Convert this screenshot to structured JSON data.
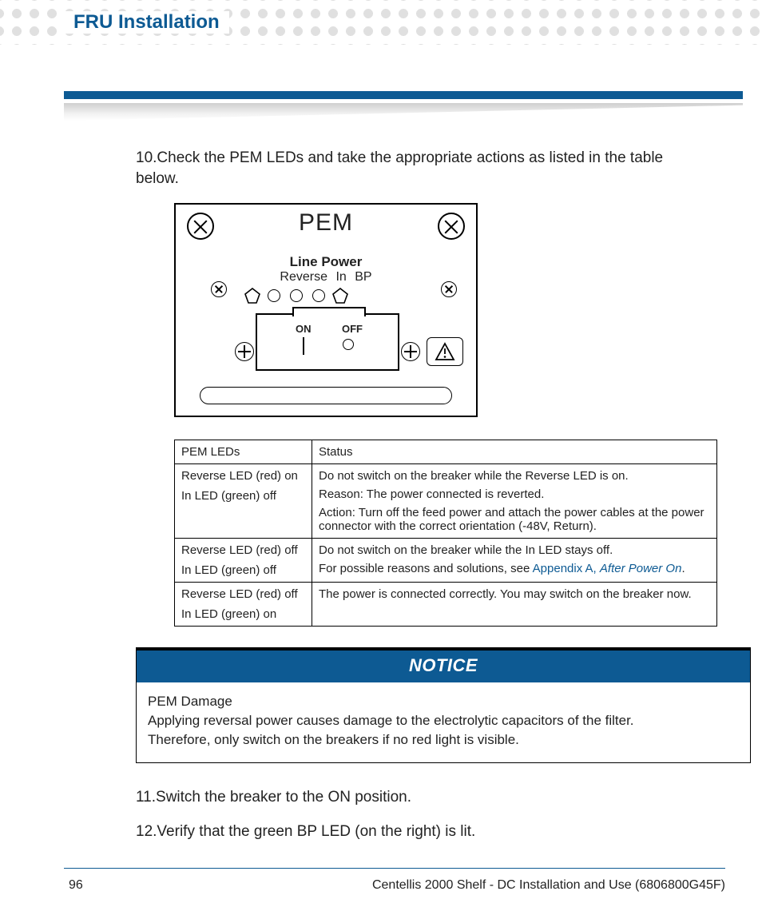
{
  "header": {
    "section_title": "FRU Installation"
  },
  "steps": {
    "s10": {
      "num": "10.",
      "text": "Check the PEM LEDs and take the appropriate actions as listed in the table below."
    },
    "s11": {
      "num": "11.",
      "text": "Switch the breaker to the ON position."
    },
    "s12": {
      "num": "12.",
      "text": "Verify that the green BP LED (on the right) is lit."
    }
  },
  "pem_diagram": {
    "title": "PEM",
    "line_power": "Line Power",
    "led_labels": "Reverse  In   BP",
    "on": "ON",
    "off": "OFF"
  },
  "led_table": {
    "headers": {
      "c1": "PEM LEDs",
      "c2": "Status"
    },
    "rows": [
      {
        "leds": [
          "Reverse LED (red) on",
          "In LED (green) off"
        ],
        "status": [
          "Do not switch on the breaker while the Reverse LED is on.",
          "Reason: The power connected is reverted.",
          "Action: Turn off the feed power and attach the power cables at the power connector with the correct orientation (-48V, Return)."
        ]
      },
      {
        "leds": [
          "Reverse LED (red) off",
          "In LED (green) off"
        ],
        "status": [
          "Do not switch on the breaker while the In LED stays off."
        ],
        "ref_prefix": "For possible reasons and solutions, see ",
        "ref_a": "Appendix A, ",
        "ref_link": "After Power On",
        "ref_suffix": "."
      },
      {
        "leds": [
          "Reverse LED (red) off",
          "In LED (green) on"
        ],
        "status": [
          "The power is connected correctly. You may switch on the breaker now."
        ]
      }
    ]
  },
  "notice": {
    "label": "NOTICE",
    "title": "PEM Damage",
    "line1": "Applying reversal power causes damage to the electrolytic capacitors of the filter.",
    "line2": "Therefore, only switch on the breakers if no red light is visible."
  },
  "footer": {
    "page": "96",
    "doc": "Centellis 2000 Shelf - DC Installation and Use (6806800G45F)"
  }
}
